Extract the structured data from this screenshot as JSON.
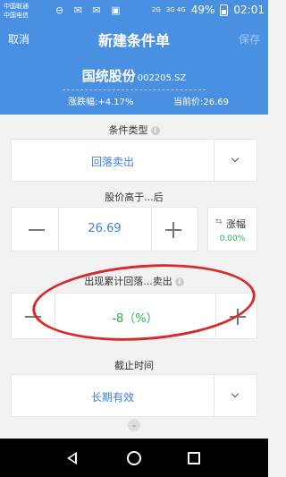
{
  "status_bar": {
    "carrier1": "中国联通",
    "carrier2": "中国电信",
    "icons": "⊖ ✉ ✉ ▣",
    "sig1": "2G",
    "sig2": "3G 4G",
    "battery": "49%",
    "time": "02:01"
  },
  "header": {
    "cancel": "取消",
    "title": "新建条件单",
    "save": "保存",
    "stock_name": "国统股份",
    "stock_code": "002205.SZ",
    "change_label": "涨跌幅:",
    "change_value": "+4.17%",
    "price_label": "当前价:",
    "price_value": "26.69"
  },
  "condition_type": {
    "label": "条件类型",
    "value": "回落卖出"
  },
  "trigger_price": {
    "label": "股价高于...后",
    "value": "26.69",
    "side_label": "涨幅",
    "side_value": "0.00%"
  },
  "drawdown": {
    "label": "出现累计回落...卖出",
    "value": "-8（%）"
  },
  "deadline": {
    "label": "截止时间",
    "value": "长期有效"
  },
  "colors": {
    "primary": "#4a90e2",
    "accent_text": "#3b82d8",
    "green": "#2bb34a",
    "annotation_red": "#d62b2b"
  }
}
